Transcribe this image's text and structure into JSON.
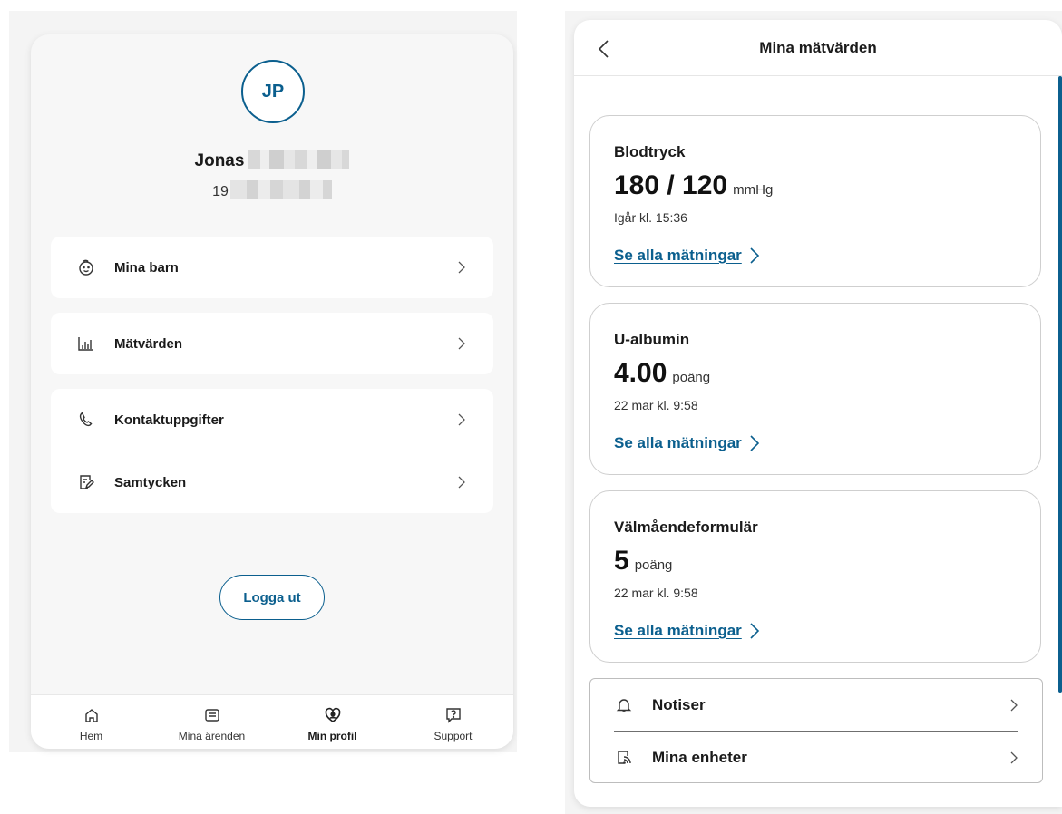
{
  "profile": {
    "initials": "JP",
    "first_name": "Jonas",
    "pnr_prefix": "19",
    "menu": [
      {
        "label": "Mina barn",
        "icon": "baby-icon"
      },
      {
        "label": "Mätvärden",
        "icon": "bar-chart-icon"
      },
      {
        "label": "Kontaktuppgifter",
        "icon": "phone-icon"
      },
      {
        "label": "Samtycken",
        "icon": "consent-form-icon"
      }
    ],
    "logout_label": "Logga ut"
  },
  "nav": [
    {
      "label": "Hem",
      "icon": "home-icon",
      "active": false
    },
    {
      "label": "Mina ärenden",
      "icon": "folder-icon",
      "active": false
    },
    {
      "label": "Min profil",
      "icon": "profile-heart-icon",
      "active": true
    },
    {
      "label": "Support",
      "icon": "help-icon",
      "active": false
    }
  ],
  "measurements": {
    "title": "Mina mätvärden",
    "cards": [
      {
        "title": "Blodtryck",
        "value": "180 / 120",
        "unit": "mmHg",
        "time": "Igår kl. 15:36",
        "link": "Se alla mätningar"
      },
      {
        "title": "U-albumin",
        "value": "4.00",
        "unit": "poäng",
        "time": "22 mar kl. 9:58",
        "link": "Se alla mätningar"
      },
      {
        "title": "Välmåendeformulär",
        "value": "5",
        "unit": "poäng",
        "time": "22 mar kl. 9:58",
        "link": "Se alla mätningar"
      }
    ],
    "settings": [
      {
        "label": "Notiser",
        "icon": "bell-icon"
      },
      {
        "label": "Mina enheter",
        "icon": "device-icon"
      }
    ]
  },
  "colors": {
    "accent": "#0b5f8e",
    "text": "#1a1a1a",
    "panel_bg": "#f7f7f7",
    "border": "#cfcfcf"
  }
}
